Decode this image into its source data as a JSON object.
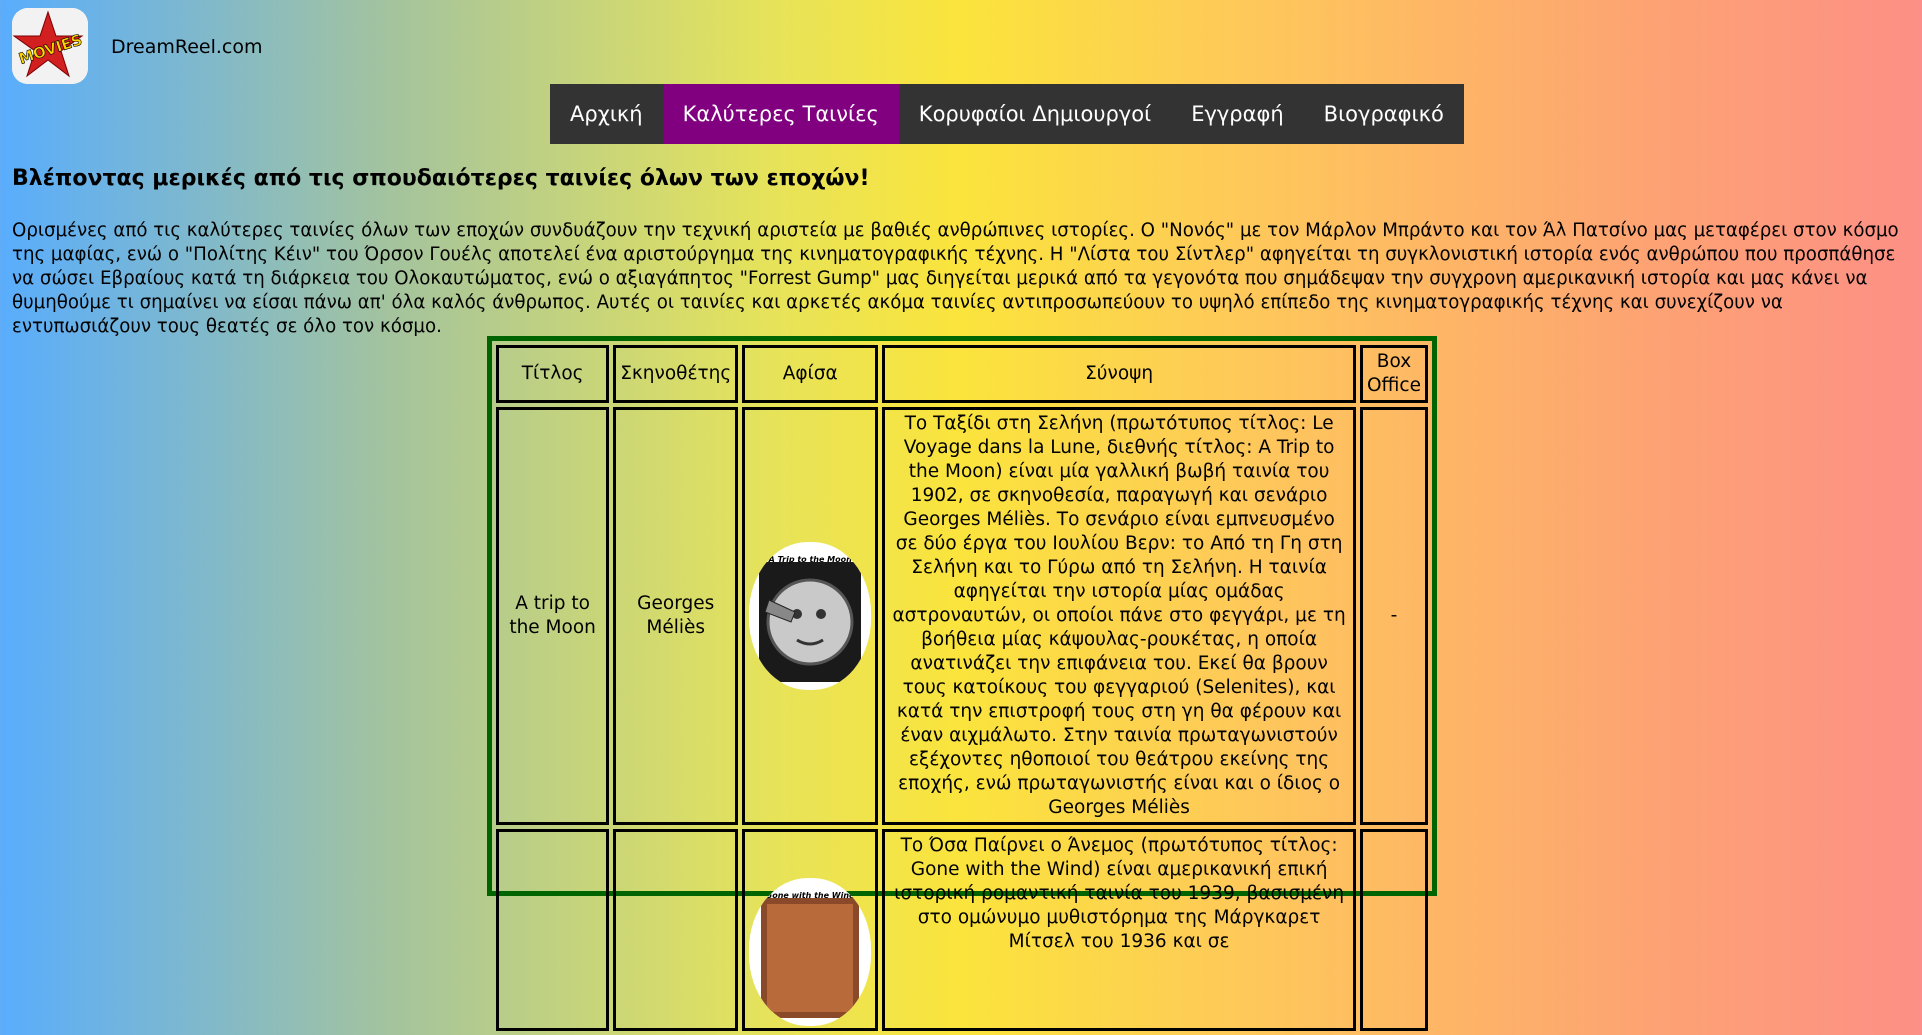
{
  "header": {
    "site_name": "DreamReel.com",
    "logo_text": "MOVIES",
    "logo_icon": "movies-star-logo"
  },
  "nav": {
    "items": [
      {
        "label": "Αρχική"
      },
      {
        "label": "Καλύτερες Ταινίες",
        "active": true
      },
      {
        "label": "Κορυφαίοι Δημιουργοί"
      },
      {
        "label": "Εγγραφή"
      },
      {
        "label": "Βιογραφικό"
      }
    ],
    "active_color": "#800080",
    "bar_color": "#333333"
  },
  "main": {
    "heading": "Βλέποντας μερικές από τις σπουδαιότερες ταινίες όλων των εποχών!",
    "intro": "Ορισμένες από τις καλύτερες ταινίες όλων των εποχών συνδυάζουν την τεχνική αριστεία με βαθιές ανθρώπινες ιστορίες. Ο \"Νονός\" με τον Μάρλον Μπράντο και τον Άλ Πατσίνο μας μεταφέρει στον κόσμο της μαφίας, ενώ ο \"Πολίτης Κέιν\" του Όρσον Γουέλς αποτελεί ένα αριστούργημα της κινηματογραφικής τέχνης. Η \"Λίστα του Σίντλερ\" αφηγείται τη συγκλονιστική ιστορία ενός ανθρώπου που προσπάθησε να σώσει Εβραίους κατά τη διάρκεια του Ολοκαυτώματος, ενώ ο αξιαγάπητος \"Forrest Gump\" μας διηγείται μερικά από τα γεγονότα που σημάδεψαν την συγχρονη αμερικανική ιστορία και μας κάνει να θυμηθούμε τι σημαίνει να είσαι πάνω απ' όλα καλός άνθρωπος. Αυτές οι ταινίες και αρκετές ακόμα ταινίες αντιπροσωπεύουν το υψηλό επίπεδο της κινηματογραφικής τέχνης και συνεχίζουν να εντυπωσιάζουν τους θεατές σε όλο τον κόσμο."
  },
  "table": {
    "headers": {
      "title": "Τίτλος",
      "director": "Σκηνοθέτης",
      "poster": "Αφίσα",
      "synopsis": "Σύνοψη",
      "box_office": "Box Office"
    },
    "rows": [
      {
        "title": "A trip to the Moon",
        "director": "Georges Méliès",
        "poster_caption": "A Trip to the Moon",
        "synopsis": "Το Ταξίδι στη Σελήνη (πρωτότυπος τίτλος: Le Voyage dans la Lune, διεθνής τίτλος: A Trip to the Moon) είναι μία γαλλική βωβή ταινία του 1902, σε σκηνοθεσία, παραγωγή και σενάριο Georges Méliès. Το σενάριο είναι εμπνευσμένο σε δύο έργα του Ιουλίου Βερν: το Από τη Γη στη Σελήνη και το Γύρω από τη Σελήνη. Η ταινία αφηγείται την ιστορία μίας ομάδας αστροναυτών, οι οποίοι πάνε στο φεγγάρι, με τη βοήθεια μίας κάψουλας-ρουκέτας, η οποία ανατινάζει την επιφάνεια του. Εκεί θα βρουν τους κατοίκους του φεγγαριού (Selenites), και κατά την επιστροφή τους στη γη θα φέρουν και έναν αιχμάλωτο. Στην ταινία πρωταγωνιστούν εξέχοντες ηθοποιοί του θεάτρου εκείνης της εποχής, ενώ πρωταγωνιστής είναι και ο ίδιος ο Georges Méliès",
        "box_office": "-"
      },
      {
        "title": "",
        "director": "",
        "poster_caption": "Gone with the Wind",
        "synopsis": "Το Όσα Παίρνει ο Άνεμος (πρωτότυπος τίτλος: Gone with the Wind) είναι αμερικανική επική ιστορική ρομαντική ταινία του 1939, βασισμένη στο ομώνυμο μυθιστόρημα της Μάργκαρετ Μίτσελ του 1936 και σε",
        "box_office": ""
      }
    ]
  },
  "colors": {
    "table_border": "#006400"
  }
}
